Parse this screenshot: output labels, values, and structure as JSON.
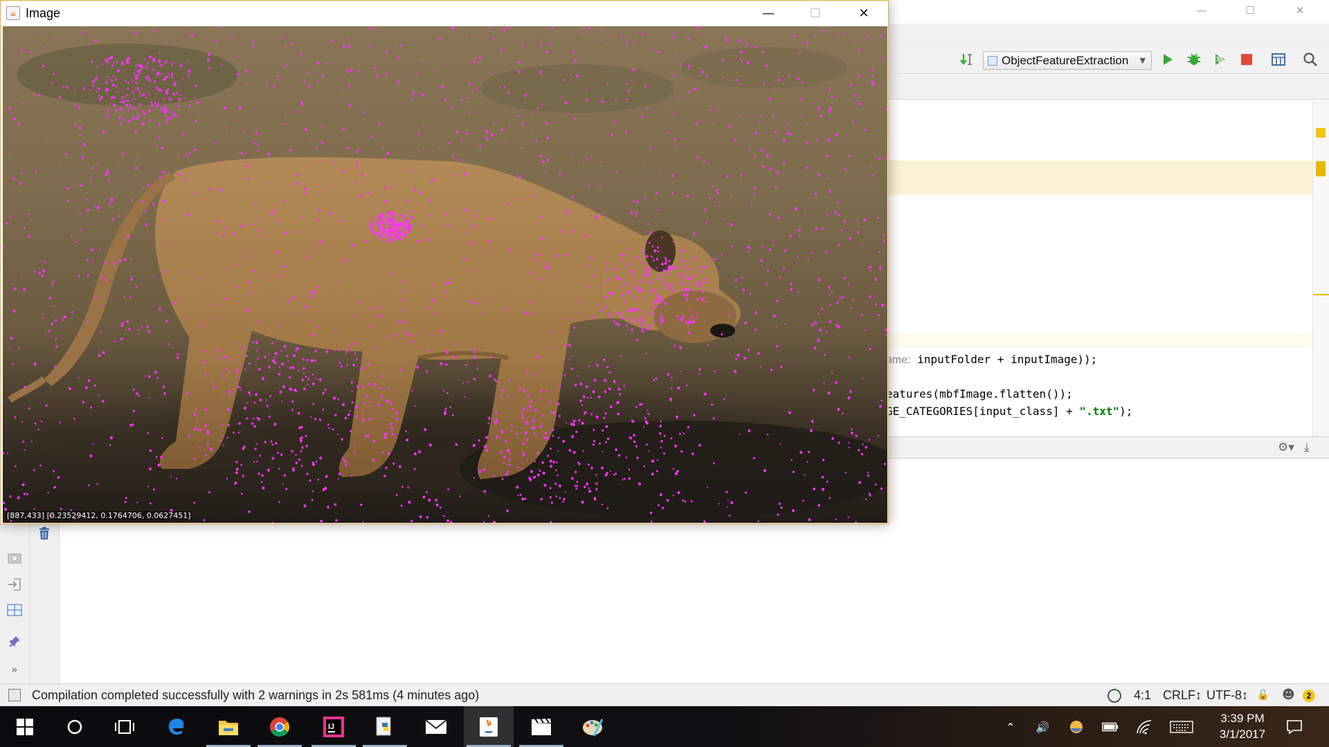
{
  "ide": {
    "run_configuration": "ObjectFeatureExtraction",
    "code_lines": [
      {
        "prefix_param": "ame:",
        "text": " inputFolder + inputImage));"
      },
      {
        "text": "eatures(mbfImage.flatten());"
      },
      {
        "text": "GE_CATEGORIES[input_class] + ",
        "string_literal": "\".txt\"",
        "suffix": ");"
      }
    ],
    "status_message": "Compilation completed successfully with 2 warnings in 2s 581ms (4 minutes ago)",
    "status_position": "4:1",
    "status_line_separator": "CRLF↕",
    "status_encoding": "UTF-8↕",
    "notification_count": "2",
    "toolbar_icons": [
      "build-icon",
      "run-icon",
      "debug-icon",
      "coverage-icon",
      "stop-icon",
      "project-structure-icon",
      "search-icon"
    ]
  },
  "image_window": {
    "title": "Image",
    "pixel_readout": "[887,433] [0.23529412, 0.1764706, 0.0627451]",
    "content": "lion photo with magenta feature points"
  },
  "taskbar": {
    "apps": [
      "start-icon",
      "cortana-icon",
      "task-view-icon",
      "edge-icon",
      "file-explorer-icon",
      "chrome-icon",
      "intellij-icon",
      "python-icon",
      "mail-icon",
      "java-icon",
      "movies-icon",
      "paint-icon"
    ],
    "active_app": "java-icon",
    "clock_time": "3:39 PM",
    "clock_date": "3/1/2017"
  },
  "colors": {
    "feature_point": "#ff33ff",
    "accent_run": "#3aa93a",
    "accent_stop": "#e04a3a",
    "line_highlight": "#fbf3d4"
  }
}
